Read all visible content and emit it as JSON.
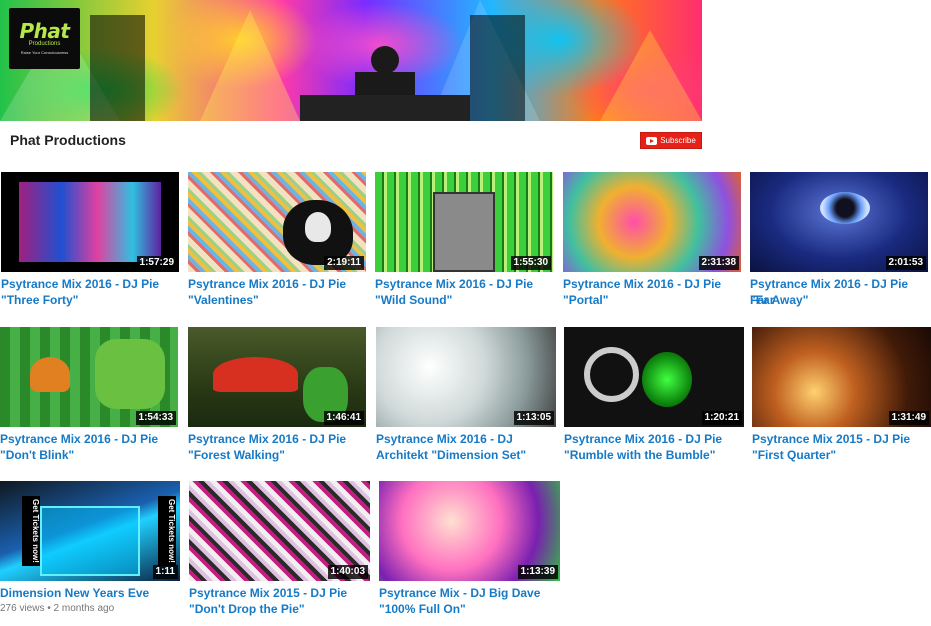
{
  "banner": {
    "logo": {
      "word": "Phat",
      "sub": "Productions",
      "tagline": "Raise Your Consciousness"
    }
  },
  "channel": {
    "name": "Phat Productions",
    "subscribe_label": "Subscribe"
  },
  "videos": [
    {
      "title_line1": "Psytrance Mix 2016 - DJ Pie",
      "title_line2": "\"Three Forty\"",
      "duration": "1:57:29"
    },
    {
      "title_line1": "Psytrance Mix 2016 - DJ Pie",
      "title_line2": "\"Valentines\"",
      "duration": "2:19:11"
    },
    {
      "title_line1": "Psytrance Mix 2016 - DJ Pie",
      "title_line2": "\"Wild Sound\"",
      "duration": "1:55:30"
    },
    {
      "title_line1": "Psytrance Mix 2016 - DJ Pie",
      "title_line2": "\"Portal\"",
      "duration": "2:31:38"
    },
    {
      "title_line1": "Psytrance Mix 2016 - DJ Pie \"Far",
      "title_line2": "Far Away\"",
      "duration": "2:01:53"
    },
    {
      "title_line1": "Psytrance Mix 2016 - DJ Pie",
      "title_line2": "\"Don't Blink\"",
      "duration": "1:54:33"
    },
    {
      "title_line1": "Psytrance Mix 2016 - DJ Pie",
      "title_line2": "\"Forest Walking\"",
      "duration": "1:46:41"
    },
    {
      "title_line1": "Psytrance Mix 2016 - DJ",
      "title_line2": "Architekt \"Dimension Set\"",
      "duration": "1:13:05"
    },
    {
      "title_line1": "Psytrance Mix 2016 - DJ Pie",
      "title_line2": "\"Rumble with the Bumble\"",
      "duration": "1:20:21"
    },
    {
      "title_line1": "Psytrance Mix 2015 - DJ Pie",
      "title_line2": "\"First Quarter\"",
      "duration": "1:31:49"
    },
    {
      "title_line1": "Dimension New Years Eve",
      "title_line2": "",
      "duration": "1:11",
      "views": "276 views",
      "age": "2 months ago",
      "side_text": "Get Tickets now!"
    },
    {
      "title_line1": "Psytrance Mix 2015 - DJ Pie",
      "title_line2": "\"Don't Drop the Pie\"",
      "duration": "1:40:03"
    },
    {
      "title_line1": "Psytrance Mix - DJ Big Dave",
      "title_line2": "\"100% Full On\"",
      "duration": "1:13:39"
    }
  ]
}
